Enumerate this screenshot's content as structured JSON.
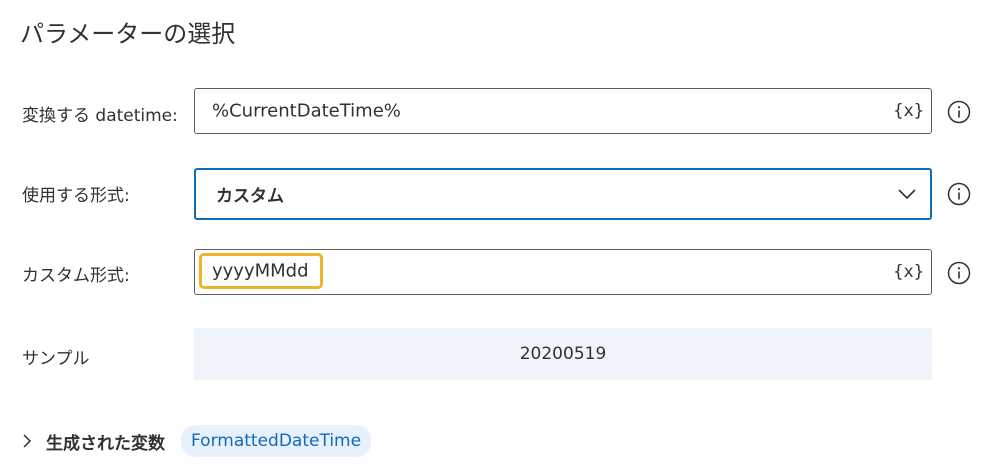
{
  "page": {
    "title": "パラメーターの選択"
  },
  "fields": {
    "datetime": {
      "label": "変換する datetime:",
      "value": "%CurrentDateTime%",
      "var_icon": "{x}"
    },
    "format": {
      "label": "使用する形式:",
      "value": "カスタム"
    },
    "custom_format": {
      "label": "カスタム形式:",
      "value": "yyyyMMdd",
      "var_icon": "{x}"
    },
    "sample": {
      "label": "サンプル",
      "value": "20200519"
    }
  },
  "generated": {
    "label": "生成された変数",
    "variable": "FormattedDateTime"
  },
  "icons": {
    "info": "info-icon",
    "chevron_down": "chevron-down-icon",
    "chevron_right": "chevron-right-icon"
  },
  "colors": {
    "focus_border": "#0f6cbd",
    "highlight": "#f0b429",
    "sample_bg": "#eef4f9",
    "pill_bg": "#e8f1fb",
    "pill_text": "#0f6cbd"
  }
}
